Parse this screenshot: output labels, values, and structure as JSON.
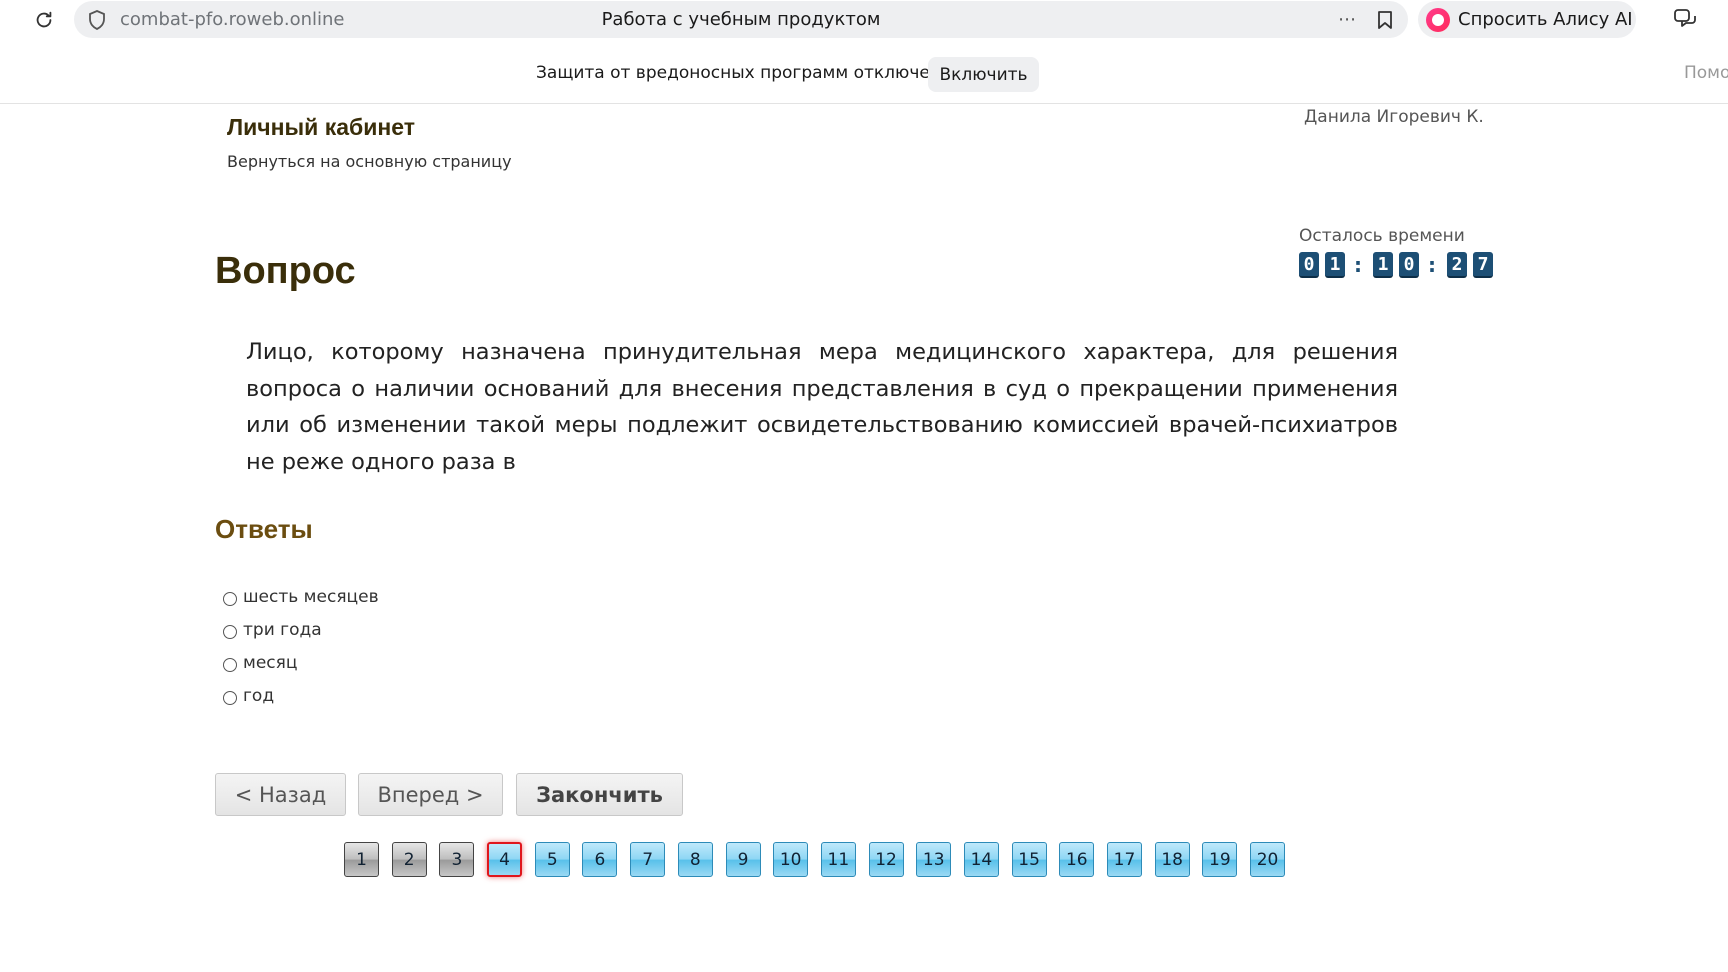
{
  "browser": {
    "url": "combat-pfo.roweb.online",
    "tab_title": "Работа с учебным продуктом",
    "more_icon": "more-icon",
    "alice_label": "Спросить Алису AI",
    "notice_text": "Защита от вредоносных программ отключена",
    "enable_label": "Включить",
    "help_label": "Помо"
  },
  "header": {
    "cabinet_title": "Личный кабинет",
    "back_link": "Вернуться на основную страницу",
    "user_name": "Данила Игоревич К."
  },
  "timer": {
    "label": "Осталось времени",
    "digits": [
      "0",
      "1",
      "1",
      "0",
      "2",
      "7"
    ],
    "separator": ":"
  },
  "question": {
    "heading": "Вопрос",
    "text": "Лицо, которому назначена принудительная мера медицинского характера, для решения вопроса о наличии оснований для внесения представления в суд о прекращении применения или об изменении такой меры подлежит освидетельствованию комиссией врачей-психиатров не реже одного раза в"
  },
  "answers": {
    "heading": "Ответы",
    "options": [
      "шесть месяцев",
      "три года",
      "месяц",
      "год"
    ]
  },
  "navigation": {
    "back_label": "< Назад",
    "next_label": "Вперед >",
    "finish_label": "Закончить"
  },
  "pager": {
    "pages": [
      "1",
      "2",
      "3",
      "4",
      "5",
      "6",
      "7",
      "8",
      "9",
      "10",
      "11",
      "12",
      "13",
      "14",
      "15",
      "16",
      "17",
      "18",
      "19",
      "20"
    ],
    "current": 4,
    "visited": [
      1,
      2,
      3
    ]
  },
  "colors": {
    "heading": "#3a2e0a",
    "answers_heading": "#6b4d10",
    "timer_digit": "#1d4f75",
    "current_page_border": "#e0161c"
  }
}
